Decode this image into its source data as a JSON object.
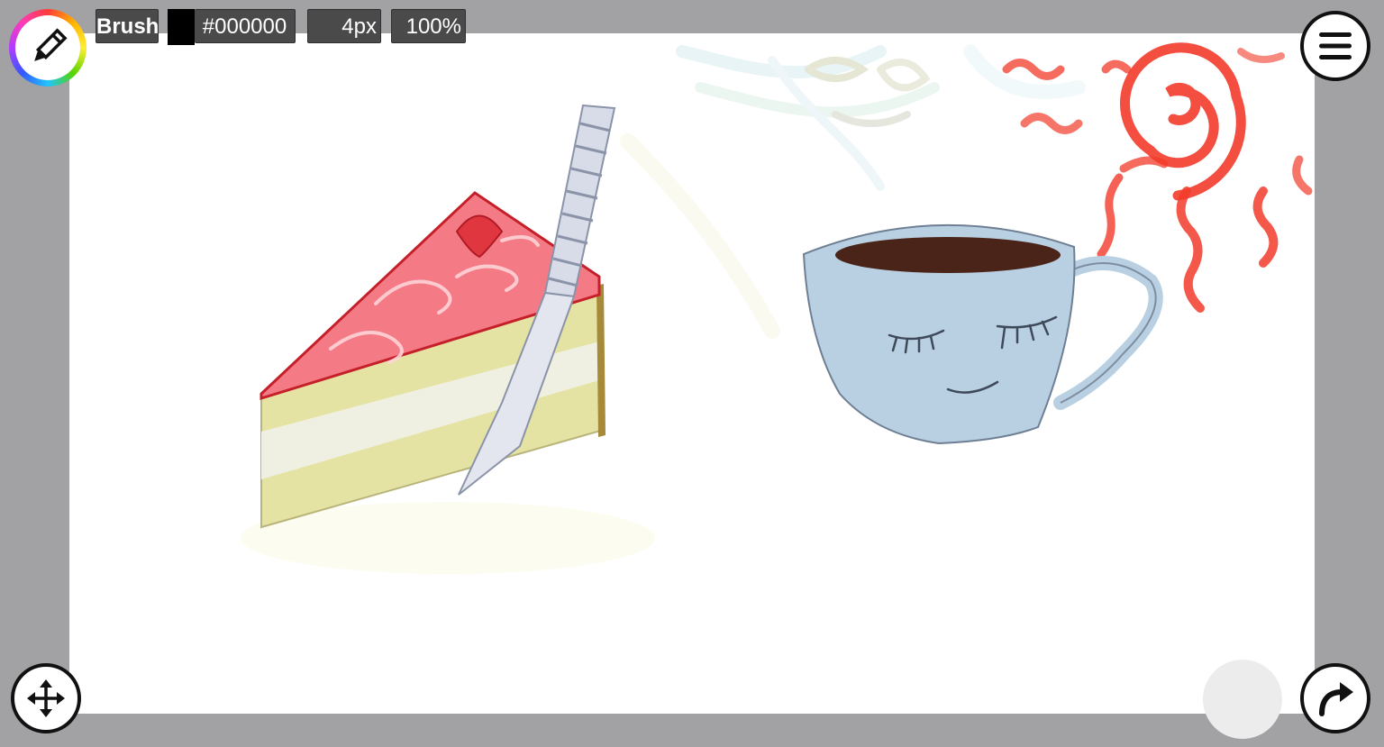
{
  "toolbar": {
    "tool_label": "Brush",
    "color_swatch": "#000000",
    "color_hex_label": "#000000",
    "brush_size_label": "4px",
    "zoom_label": "100%"
  },
  "buttons": {
    "tool_icon": "pencil-icon",
    "menu_icon": "hamburger-menu-icon",
    "move_icon": "move-arrows-icon",
    "redo_icon": "redo-arrow-icon"
  },
  "drawing": {
    "subjects": [
      "cake-slice",
      "knife",
      "coffee-cup",
      "sun"
    ],
    "colors": {
      "frosting": "#f47b86",
      "frosting_edge": "#c5202a",
      "sponge": "#e5e3a4",
      "cream": "#f0f0e2",
      "cup": "#b9d0e2",
      "coffee": "#4a2418",
      "sun": "#f23b2a",
      "knife": "#d7dce8"
    }
  },
  "colors": {
    "background": "#a2a1a3",
    "canvas": "#ffffff",
    "chip": "#4a4a4a"
  }
}
